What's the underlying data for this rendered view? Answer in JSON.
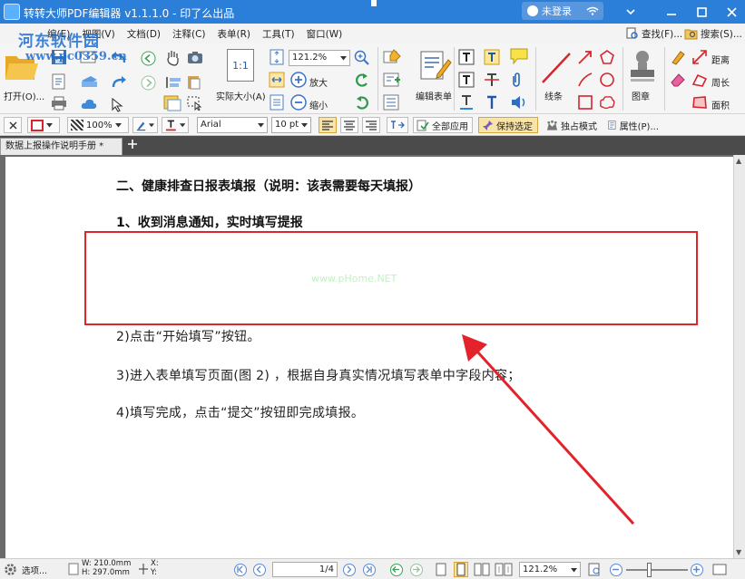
{
  "titlebar": {
    "title": "转转大师PDF编辑器 v1.1.1.0 - 印了么出品",
    "login_label": "未登录"
  },
  "menubar": {
    "items": [
      "编(E)",
      "视图(V)",
      "文档(D)",
      "注释(C)",
      "表单(R)",
      "工具(T)",
      "窗口(W)"
    ],
    "find_label": "查找(F)...",
    "search_label": "搜索(S)..."
  },
  "ribbon": {
    "open_label": "打开(O)...",
    "actual_size_label": "实际大小(A)",
    "actual_size_badge": "1:1",
    "zoom_value": "121.2%",
    "zoom_in_label": "放大",
    "zoom_out_label": "缩小",
    "edit_form_label": "编辑表单",
    "line_label": "线条",
    "stamp_label": "图章",
    "distance_label": "距离",
    "perimeter_label": "周长",
    "area_label": "面积"
  },
  "formatbar": {
    "opacity_value": "100%",
    "font_value": "Arial",
    "font_size_value": "10 pt",
    "apply_all_label": "全部应用",
    "keep_selected_label": "保持选定",
    "exclusive_mode_label": "独占模式",
    "properties_label": "属性(P)..."
  },
  "tabs": {
    "doc_tab_label": "数据上报操作说明手册 *"
  },
  "document": {
    "heading_main": "二、健康排查日报表填报（说明：该表需要每天填报）",
    "heading_sub": "1、收到消息通知，实时填写提报",
    "step2": "2)点击“开始填写”按钮。",
    "step3": "3)进入表单填写页面(图 2) ，根据自身真实情况填写表单中字段内容；",
    "step4": "4)填写完成，点击“提交”按钮即完成填报。",
    "redacted_watermark": "www.pHome.NET"
  },
  "statusbar": {
    "options_label": "选项...",
    "page_w": "W: 210.0mm",
    "page_h": "H: 297.0mm",
    "x_label": "X:",
    "y_label": "Y:",
    "page_current": "1",
    "page_total": "/4",
    "zoom_value": "121.2%"
  },
  "watermark": {
    "line1": "河东软件园",
    "line2": "www.pc0359.cn"
  },
  "colors": {
    "titlebar": "#2b7fd8",
    "highlight": "#e3232c",
    "arrow": "#e3232c",
    "active_button": "#f8e3a9"
  }
}
